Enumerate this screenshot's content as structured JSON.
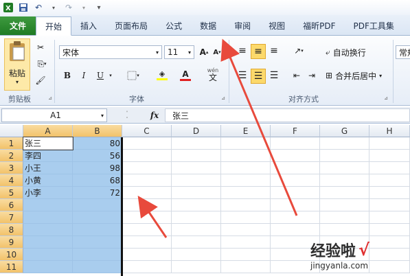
{
  "window": {
    "qat_icons": [
      "save-icon",
      "undo-icon",
      "redo-icon",
      "customize-icon"
    ]
  },
  "tabs": [
    "文件",
    "开始",
    "插入",
    "页面布局",
    "公式",
    "数据",
    "审阅",
    "视图",
    "福昕PDF",
    "PDF工具集"
  ],
  "ribbon": {
    "paste_label": "粘贴",
    "clipboard_label": "剪贴板",
    "font_name": "宋体",
    "font_size": "11",
    "font_group_label": "字体",
    "bold": "B",
    "italic": "I",
    "underline": "U",
    "align_group_label": "对齐方式",
    "wrap_text": "自动换行",
    "merge_center": "合并后居中",
    "number_format": "常规",
    "wen_label": "wén",
    "wen_char": "文"
  },
  "formula_bar": {
    "name_box": "A1",
    "fx": "fx",
    "content": "张三"
  },
  "sheet": {
    "columns": [
      "A",
      "B",
      "C",
      "D",
      "E",
      "F",
      "G",
      "H"
    ],
    "rows": [
      "1",
      "2",
      "3",
      "4",
      "5",
      "6",
      "7",
      "8",
      "9",
      "10",
      "11"
    ],
    "data": [
      [
        "张三",
        "80"
      ],
      [
        "李四",
        "56"
      ],
      [
        "小王",
        "98"
      ],
      [
        "小黄",
        "68"
      ],
      [
        "小李",
        "72"
      ]
    ]
  },
  "watermark": {
    "text": "经验啦",
    "check": "√",
    "url": "jingyanla.com"
  },
  "colors": {
    "file_tab": "#2a8a2f",
    "selection": "#a9cdee",
    "arrow": "#e84a3c"
  }
}
